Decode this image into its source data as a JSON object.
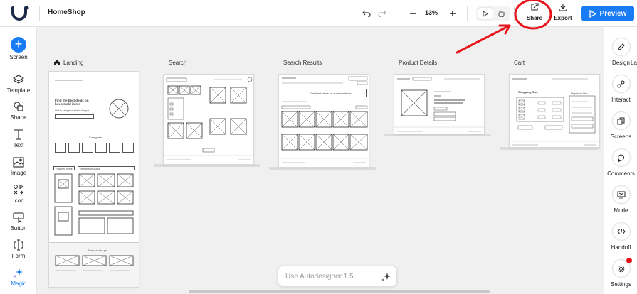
{
  "app": {
    "project_title": "HomeShop"
  },
  "toolbar": {
    "zoom": "13%",
    "share_label": "Share",
    "export_label": "Export",
    "preview_label": "Preview"
  },
  "left_tools": [
    {
      "label": "Screen",
      "icon": "plus-icon"
    },
    {
      "label": "Template",
      "icon": "layers-icon"
    },
    {
      "label": "Shape",
      "icon": "shape-icon"
    },
    {
      "label": "Text",
      "icon": "text-icon"
    },
    {
      "label": "Image",
      "icon": "image-icon"
    },
    {
      "label": "Icon",
      "icon": "icon-set-icon"
    },
    {
      "label": "Button",
      "icon": "button-icon"
    },
    {
      "label": "Form",
      "icon": "form-icon"
    },
    {
      "label": "Magic",
      "icon": "magic-icon"
    }
  ],
  "right_tools": [
    {
      "label": "Design",
      "icon": "pencil-icon"
    },
    {
      "label": "Interact",
      "icon": "link-icon"
    },
    {
      "label": "Screens",
      "icon": "screens-icon"
    },
    {
      "label": "Comments",
      "icon": "comment-icon"
    },
    {
      "label": "Mode",
      "icon": "mode-icon"
    },
    {
      "label": "Handoff",
      "icon": "code-icon"
    },
    {
      "label": "Settings",
      "icon": "gear-icon"
    }
  ],
  "frames": [
    {
      "label": "Landing"
    },
    {
      "label": "Search"
    },
    {
      "label": "Search Results"
    },
    {
      "label": "Product Details"
    },
    {
      "label": "Cart"
    },
    {
      "label": "Lay"
    }
  ],
  "wireframe_text": {
    "landing_headline": "Find the best deals on household items",
    "landing_sub": "Get a range of items for you",
    "landing_categories": "Categories",
    "landing_featured": "Featured Items",
    "landing_trending": "Trending products",
    "landing_shop": "Shop on the go",
    "results_banner": "Get best deals on summer items!",
    "cart_title": "Shopping Cart",
    "cart_summary": "Payment Info"
  },
  "autodesigner": {
    "placeholder": "Use Autodesigner 1.5"
  },
  "colors": {
    "accent": "#1a7cf5",
    "annotation": "#e8141b"
  }
}
